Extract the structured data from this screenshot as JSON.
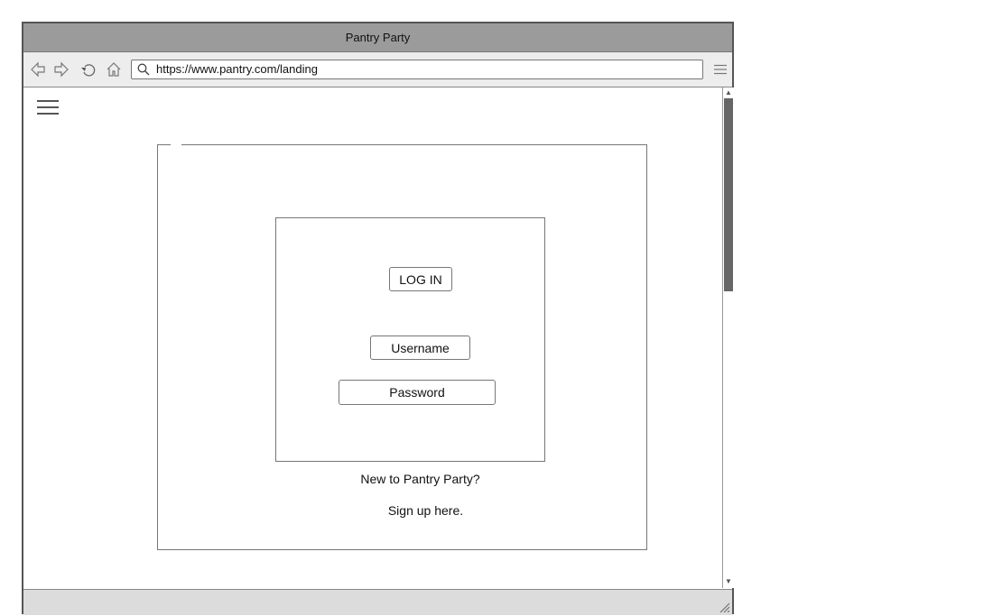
{
  "window": {
    "title": "Pantry Party"
  },
  "browser": {
    "url": "https://www.pantry.com/landing",
    "icons": {
      "back": "back-arrow-icon",
      "forward": "forward-arrow-icon",
      "reload": "reload-icon",
      "home": "home-icon",
      "search": "search-icon",
      "menu": "menu-icon"
    }
  },
  "page": {
    "menu_icon": "hamburger-menu-icon",
    "login": {
      "button_label": "LOG IN",
      "username_placeholder": "Username",
      "password_placeholder": "Password"
    },
    "signup": {
      "prompt": "New to Pantry Party?",
      "link_label": "Sign up here."
    }
  }
}
